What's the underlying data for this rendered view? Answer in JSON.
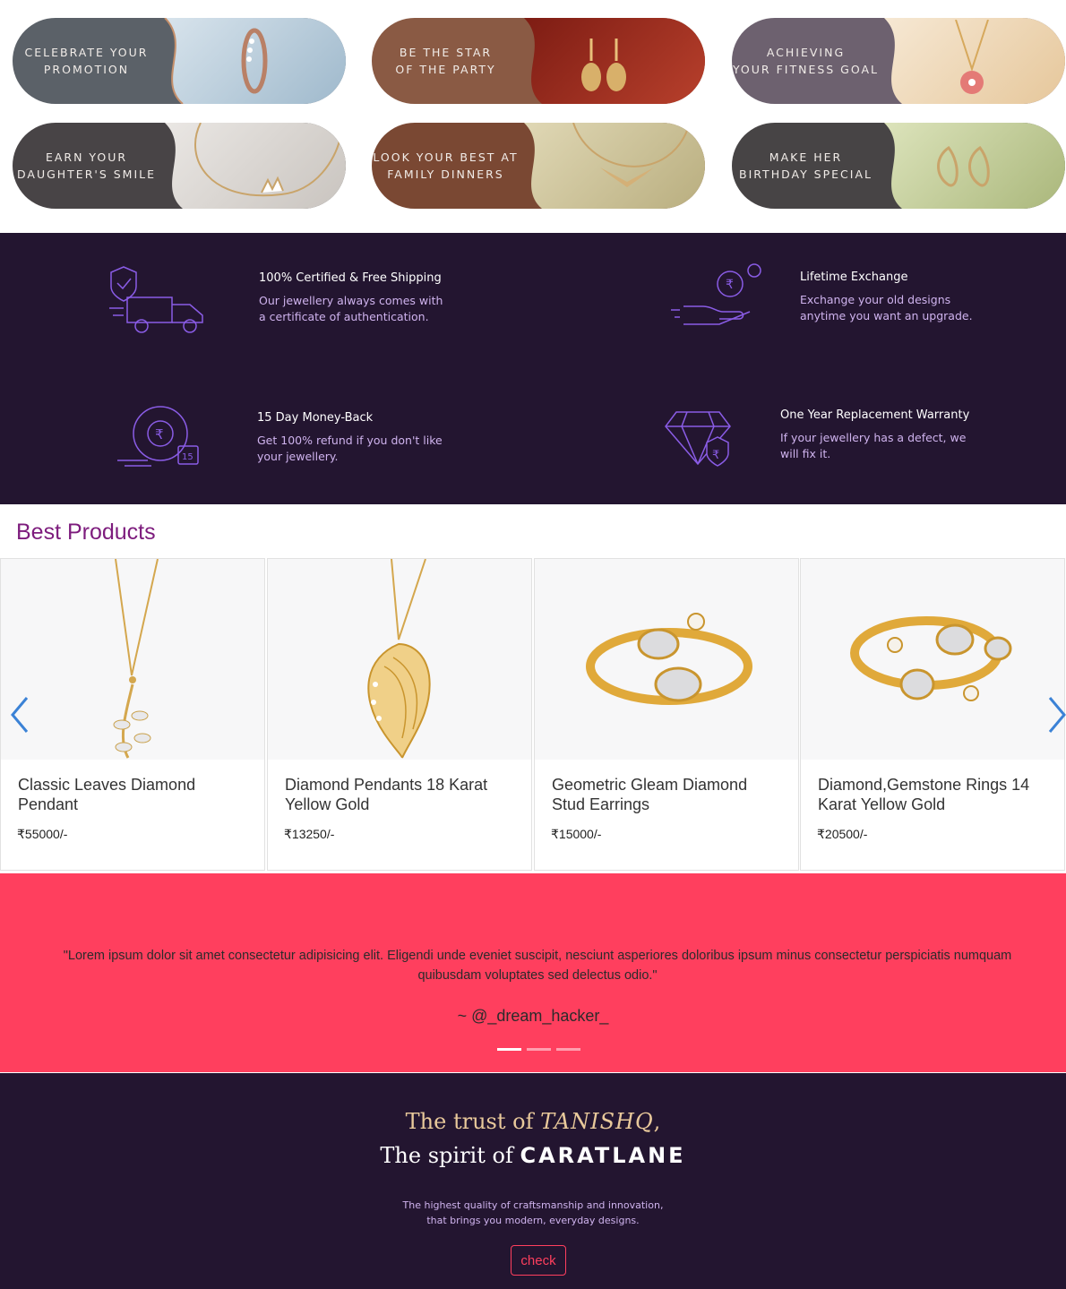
{
  "occasions": [
    {
      "label": "CELEBRATE YOUR\nPROMOTION",
      "bg": "#5b6168",
      "art_bg": "#c4d6e2"
    },
    {
      "label": "BE THE STAR\nOF THE PARTY",
      "bg": "#8a5a44",
      "art_bg": "#a8321f"
    },
    {
      "label": "ACHIEVING\nYOUR FITNESS GOAL",
      "bg": "#6d616f",
      "art_bg": "#f2e1c9"
    },
    {
      "label": "EARN YOUR\nDAUGHTER'S SMILE",
      "bg": "#484446",
      "art_bg": "#dfdcd8"
    },
    {
      "label": "LOOK YOUR BEST AT\nFAMILY DINNERS",
      "bg": "#7a4833",
      "art_bg": "#d2c9a4"
    },
    {
      "label": "MAKE HER\nBIRTHDAY SPECIAL",
      "bg": "#474445",
      "art_bg": "#c8d3a2"
    }
  ],
  "features": [
    {
      "title": "100% Certified & Free Shipping",
      "desc": "Our jewellery always comes with\na certificate of authentication.",
      "icon": "certified-shipping-icon"
    },
    {
      "title": "Lifetime Exchange",
      "desc": "Exchange your old designs\nanytime you want an upgrade.",
      "icon": "lifetime-exchange-icon"
    },
    {
      "title": "15 Day Money-Back",
      "desc": "Get 100% refund if you don't like\nyour jewellery.",
      "icon": "money-back-icon",
      "badge": "15"
    },
    {
      "title": "One Year Replacement Warranty",
      "desc": "If your jewellery has a defect, we\nwill fix it.",
      "icon": "warranty-diamond-icon"
    }
  ],
  "best_products": {
    "title": "Best Products",
    "items": [
      {
        "name": "Classic Leaves Diamond Pendant",
        "price": "₹55000/-"
      },
      {
        "name": "Diamond Pendants 18 Karat Yellow Gold",
        "price": "₹13250/-"
      },
      {
        "name": "Geometric Gleam Diamond Stud Earrings",
        "price": "₹15000/-"
      },
      {
        "name": "Diamond,Gemstone Rings 14 Karat Yellow Gold",
        "price": "₹20500/-"
      }
    ]
  },
  "testimonial": {
    "icon": "instagram-icon",
    "quote": "\"Lorem ipsum dolor sit amet consectetur adipisicing elit. Eligendi unde eveniet suscipit, nesciunt asperiores doloribus ipsum minus consectetur perspiciatis numquam quibusdam voluptates sed delectus odio.\"",
    "author": "~ @_dream_hacker_",
    "slides": 3,
    "active_slide": 1
  },
  "promo": {
    "line1_prefix": "The trust of",
    "brand1": "TANISHQ",
    "line1_suffix": ",",
    "line2_prefix": "The spirit of",
    "brand2": "CARATLANE",
    "desc": "The highest quality of craftsmanship and innovation,\nthat brings you modern, everyday designs.",
    "button": "check"
  },
  "colors": {
    "brand_dark": "#231530",
    "accent_pink": "#ff3f5e",
    "title_purple": "#7d1c7d",
    "icon_purple": "#8a5ce6"
  }
}
